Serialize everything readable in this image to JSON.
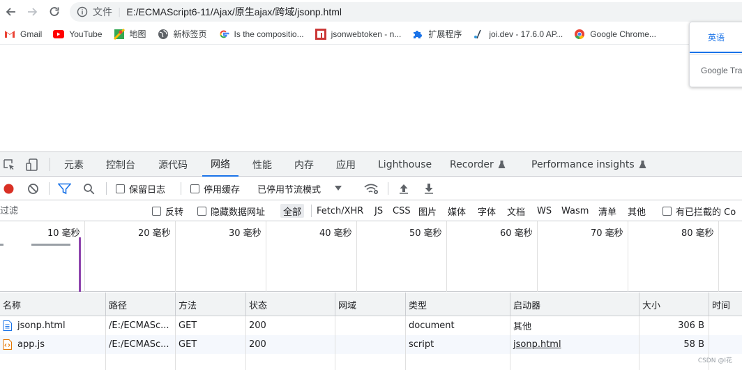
{
  "browser": {
    "scheme_label": "文件",
    "url": "E:/ECMAScript6-11/Ajax/原生ajax/跨域/jsonp.html"
  },
  "bookmarks": [
    {
      "label": "Gmail",
      "icon": "gmail-icon"
    },
    {
      "label": "YouTube",
      "icon": "youtube-icon"
    },
    {
      "label": "地图",
      "icon": "maps-icon"
    },
    {
      "label": "新标签页",
      "icon": "globe-icon"
    },
    {
      "label": "Is the compositio...",
      "icon": "google-icon"
    },
    {
      "label": "jsonwebtoken - n...",
      "icon": "npm-icon"
    },
    {
      "label": "扩展程序",
      "icon": "puzzle-icon"
    },
    {
      "label": "joi.dev - 17.6.0 AP...",
      "icon": "joi-icon"
    },
    {
      "label": "Google Chrome...",
      "icon": "chrome-icon"
    }
  ],
  "translate_popup": {
    "language_tab": "英语",
    "brand": "Google Tra"
  },
  "devtools": {
    "tabs": [
      "元素",
      "控制台",
      "源代码",
      "网络",
      "性能",
      "内存",
      "应用",
      "Lighthouse",
      "Recorder",
      "Performance insights"
    ],
    "active_tab": "网络",
    "toolbar": {
      "preserve_log": "保留日志",
      "disable_cache": "停用缓存",
      "throttling": "已停用节流模式"
    },
    "filter": {
      "placeholder": "过滤",
      "invert": "反转",
      "hide_data_urls": "隐藏数据网址",
      "types": [
        "全部",
        "Fetch/XHR",
        "JS",
        "CSS",
        "图片",
        "媒体",
        "字体",
        "文档",
        "WS",
        "Wasm",
        "清单",
        "其他"
      ],
      "active_type": "全部",
      "blocked_cookies": "有已拦截的 Co"
    },
    "timeline": {
      "ticks": [
        "10 毫秒",
        "20 毫秒",
        "30 毫秒",
        "40 毫秒",
        "50 毫秒",
        "60 毫秒",
        "70 毫秒",
        "80 毫秒"
      ]
    },
    "table": {
      "columns": [
        "名称",
        "路径",
        "方法",
        "状态",
        "网域",
        "类型",
        "启动器",
        "大小",
        "时间"
      ],
      "rows": [
        {
          "name": "jsonp.html",
          "path": "/E:/ECMASc...",
          "method": "GET",
          "status": "200",
          "domain": "",
          "type": "document",
          "initiator": "其他",
          "size": "306 B",
          "time": "",
          "icon": "document-file-icon"
        },
        {
          "name": "app.js",
          "path": "/E:/ECMASc...",
          "method": "GET",
          "status": "200",
          "domain": "",
          "type": "script",
          "initiator": "jsonp.html",
          "size": "58 B",
          "time": "",
          "icon": "script-file-icon"
        }
      ]
    }
  },
  "watermark": "CSDN @I花",
  "colors": {
    "accent": "#1a73e8",
    "record_red": "#d93025",
    "filter_blue": "#1a73e8"
  }
}
